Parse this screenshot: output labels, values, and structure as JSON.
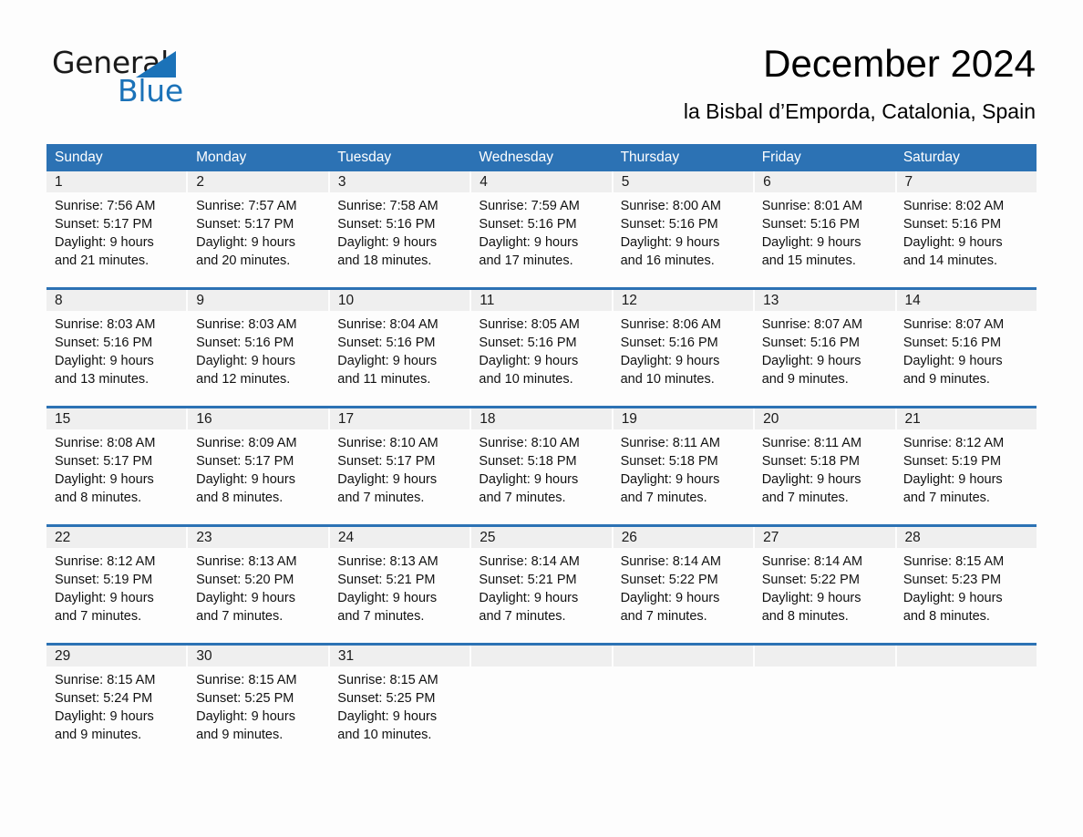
{
  "brand": {
    "name_part1": "General",
    "name_part2": "Blue",
    "triangle_color": "#1b72b8",
    "accent_color": "#2c72b4"
  },
  "header": {
    "title": "December 2024",
    "subtitle": "la Bisbal d’Emporda, Catalonia, Spain"
  },
  "weekdays": [
    "Sunday",
    "Monday",
    "Tuesday",
    "Wednesday",
    "Thursday",
    "Friday",
    "Saturday"
  ],
  "weeks": [
    [
      {
        "day": "1",
        "sunrise": "Sunrise: 7:56 AM",
        "sunset": "Sunset: 5:17 PM",
        "daylight1": "Daylight: 9 hours",
        "daylight2": "and 21 minutes."
      },
      {
        "day": "2",
        "sunrise": "Sunrise: 7:57 AM",
        "sunset": "Sunset: 5:17 PM",
        "daylight1": "Daylight: 9 hours",
        "daylight2": "and 20 minutes."
      },
      {
        "day": "3",
        "sunrise": "Sunrise: 7:58 AM",
        "sunset": "Sunset: 5:16 PM",
        "daylight1": "Daylight: 9 hours",
        "daylight2": "and 18 minutes."
      },
      {
        "day": "4",
        "sunrise": "Sunrise: 7:59 AM",
        "sunset": "Sunset: 5:16 PM",
        "daylight1": "Daylight: 9 hours",
        "daylight2": "and 17 minutes."
      },
      {
        "day": "5",
        "sunrise": "Sunrise: 8:00 AM",
        "sunset": "Sunset: 5:16 PM",
        "daylight1": "Daylight: 9 hours",
        "daylight2": "and 16 minutes."
      },
      {
        "day": "6",
        "sunrise": "Sunrise: 8:01 AM",
        "sunset": "Sunset: 5:16 PM",
        "daylight1": "Daylight: 9 hours",
        "daylight2": "and 15 minutes."
      },
      {
        "day": "7",
        "sunrise": "Sunrise: 8:02 AM",
        "sunset": "Sunset: 5:16 PM",
        "daylight1": "Daylight: 9 hours",
        "daylight2": "and 14 minutes."
      }
    ],
    [
      {
        "day": "8",
        "sunrise": "Sunrise: 8:03 AM",
        "sunset": "Sunset: 5:16 PM",
        "daylight1": "Daylight: 9 hours",
        "daylight2": "and 13 minutes."
      },
      {
        "day": "9",
        "sunrise": "Sunrise: 8:03 AM",
        "sunset": "Sunset: 5:16 PM",
        "daylight1": "Daylight: 9 hours",
        "daylight2": "and 12 minutes."
      },
      {
        "day": "10",
        "sunrise": "Sunrise: 8:04 AM",
        "sunset": "Sunset: 5:16 PM",
        "daylight1": "Daylight: 9 hours",
        "daylight2": "and 11 minutes."
      },
      {
        "day": "11",
        "sunrise": "Sunrise: 8:05 AM",
        "sunset": "Sunset: 5:16 PM",
        "daylight1": "Daylight: 9 hours",
        "daylight2": "and 10 minutes."
      },
      {
        "day": "12",
        "sunrise": "Sunrise: 8:06 AM",
        "sunset": "Sunset: 5:16 PM",
        "daylight1": "Daylight: 9 hours",
        "daylight2": "and 10 minutes."
      },
      {
        "day": "13",
        "sunrise": "Sunrise: 8:07 AM",
        "sunset": "Sunset: 5:16 PM",
        "daylight1": "Daylight: 9 hours",
        "daylight2": "and 9 minutes."
      },
      {
        "day": "14",
        "sunrise": "Sunrise: 8:07 AM",
        "sunset": "Sunset: 5:16 PM",
        "daylight1": "Daylight: 9 hours",
        "daylight2": "and 9 minutes."
      }
    ],
    [
      {
        "day": "15",
        "sunrise": "Sunrise: 8:08 AM",
        "sunset": "Sunset: 5:17 PM",
        "daylight1": "Daylight: 9 hours",
        "daylight2": "and 8 minutes."
      },
      {
        "day": "16",
        "sunrise": "Sunrise: 8:09 AM",
        "sunset": "Sunset: 5:17 PM",
        "daylight1": "Daylight: 9 hours",
        "daylight2": "and 8 minutes."
      },
      {
        "day": "17",
        "sunrise": "Sunrise: 8:10 AM",
        "sunset": "Sunset: 5:17 PM",
        "daylight1": "Daylight: 9 hours",
        "daylight2": "and 7 minutes."
      },
      {
        "day": "18",
        "sunrise": "Sunrise: 8:10 AM",
        "sunset": "Sunset: 5:18 PM",
        "daylight1": "Daylight: 9 hours",
        "daylight2": "and 7 minutes."
      },
      {
        "day": "19",
        "sunrise": "Sunrise: 8:11 AM",
        "sunset": "Sunset: 5:18 PM",
        "daylight1": "Daylight: 9 hours",
        "daylight2": "and 7 minutes."
      },
      {
        "day": "20",
        "sunrise": "Sunrise: 8:11 AM",
        "sunset": "Sunset: 5:18 PM",
        "daylight1": "Daylight: 9 hours",
        "daylight2": "and 7 minutes."
      },
      {
        "day": "21",
        "sunrise": "Sunrise: 8:12 AM",
        "sunset": "Sunset: 5:19 PM",
        "daylight1": "Daylight: 9 hours",
        "daylight2": "and 7 minutes."
      }
    ],
    [
      {
        "day": "22",
        "sunrise": "Sunrise: 8:12 AM",
        "sunset": "Sunset: 5:19 PM",
        "daylight1": "Daylight: 9 hours",
        "daylight2": "and 7 minutes."
      },
      {
        "day": "23",
        "sunrise": "Sunrise: 8:13 AM",
        "sunset": "Sunset: 5:20 PM",
        "daylight1": "Daylight: 9 hours",
        "daylight2": "and 7 minutes."
      },
      {
        "day": "24",
        "sunrise": "Sunrise: 8:13 AM",
        "sunset": "Sunset: 5:21 PM",
        "daylight1": "Daylight: 9 hours",
        "daylight2": "and 7 minutes."
      },
      {
        "day": "25",
        "sunrise": "Sunrise: 8:14 AM",
        "sunset": "Sunset: 5:21 PM",
        "daylight1": "Daylight: 9 hours",
        "daylight2": "and 7 minutes."
      },
      {
        "day": "26",
        "sunrise": "Sunrise: 8:14 AM",
        "sunset": "Sunset: 5:22 PM",
        "daylight1": "Daylight: 9 hours",
        "daylight2": "and 7 minutes."
      },
      {
        "day": "27",
        "sunrise": "Sunrise: 8:14 AM",
        "sunset": "Sunset: 5:22 PM",
        "daylight1": "Daylight: 9 hours",
        "daylight2": "and 8 minutes."
      },
      {
        "day": "28",
        "sunrise": "Sunrise: 8:15 AM",
        "sunset": "Sunset: 5:23 PM",
        "daylight1": "Daylight: 9 hours",
        "daylight2": "and 8 minutes."
      }
    ],
    [
      {
        "day": "29",
        "sunrise": "Sunrise: 8:15 AM",
        "sunset": "Sunset: 5:24 PM",
        "daylight1": "Daylight: 9 hours",
        "daylight2": "and 9 minutes."
      },
      {
        "day": "30",
        "sunrise": "Sunrise: 8:15 AM",
        "sunset": "Sunset: 5:25 PM",
        "daylight1": "Daylight: 9 hours",
        "daylight2": "and 9 minutes."
      },
      {
        "day": "31",
        "sunrise": "Sunrise: 8:15 AM",
        "sunset": "Sunset: 5:25 PM",
        "daylight1": "Daylight: 9 hours",
        "daylight2": "and 10 minutes."
      },
      {
        "day": "",
        "sunrise": "",
        "sunset": "",
        "daylight1": "",
        "daylight2": ""
      },
      {
        "day": "",
        "sunrise": "",
        "sunset": "",
        "daylight1": "",
        "daylight2": ""
      },
      {
        "day": "",
        "sunrise": "",
        "sunset": "",
        "daylight1": "",
        "daylight2": ""
      },
      {
        "day": "",
        "sunrise": "",
        "sunset": "",
        "daylight1": "",
        "daylight2": ""
      }
    ]
  ]
}
